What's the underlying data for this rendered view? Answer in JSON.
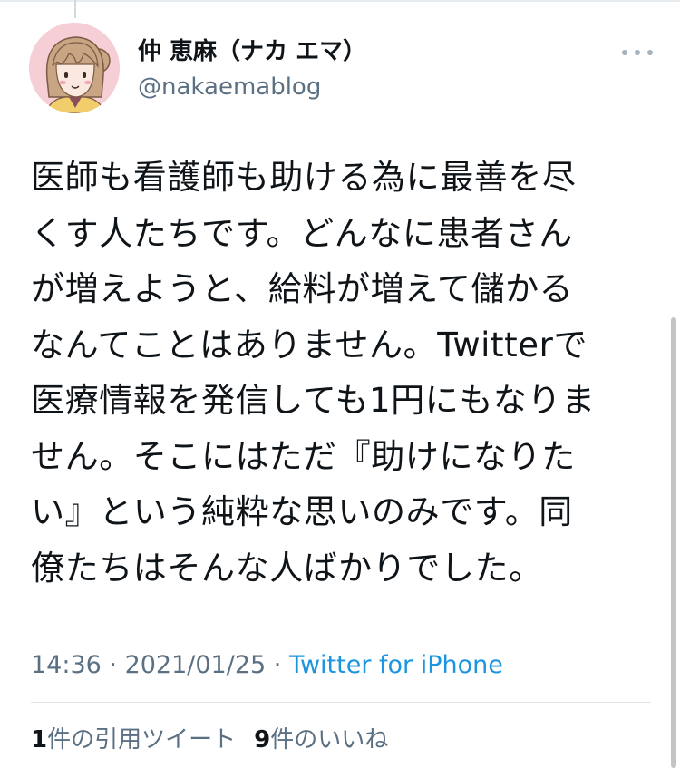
{
  "user": {
    "display_name": "仲 恵麻（ナカ エマ）",
    "handle": "@nakaemablog",
    "avatar_icon": "illustrated-girl-avatar"
  },
  "more_icon": "more-dots-icon",
  "tweet": {
    "lines": [
      "医師も看護師も助ける為に最善を尽",
      "くす人たちです。どんなに患者さん",
      "が増えようと、給料が増えて儲かる",
      "なんてことはありません。Twitterで",
      "医療情報を発信しても1円にもなりま",
      "せん。そこにはただ『助けになりた",
      "い』という純粋な思いのみです。同",
      "僚たちはそんな人ばかりでした。"
    ]
  },
  "meta": {
    "time": "14:36",
    "separator": " · ",
    "date": "2021/01/25",
    "source": "Twitter for iPhone"
  },
  "stats": {
    "quote_count": "1",
    "quote_label": "件の引用ツイート",
    "like_count": "9",
    "like_label": "件のいいね"
  },
  "colors": {
    "text": "#0f1419",
    "secondary": "#5b7083",
    "link": "#1b95e0",
    "divider": "#dfe5ea"
  }
}
